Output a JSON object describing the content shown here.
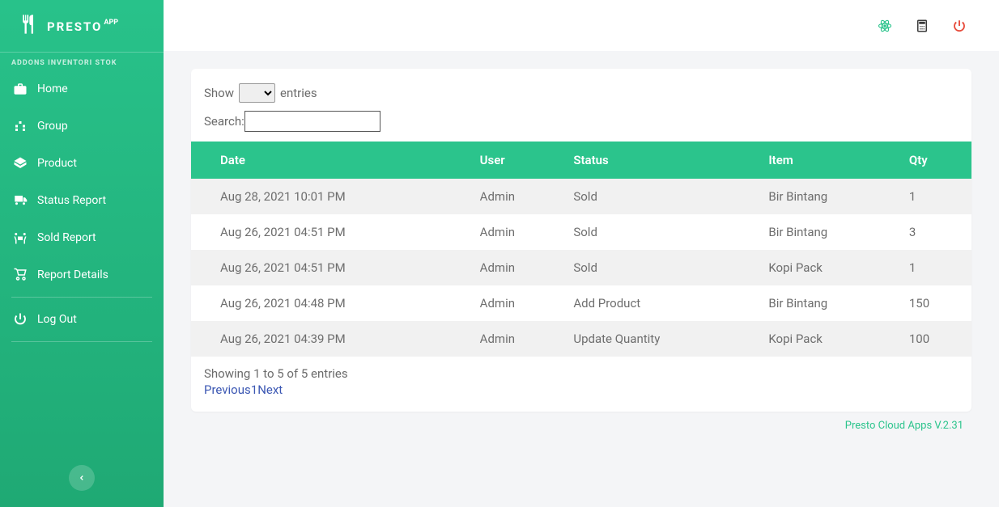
{
  "brand": {
    "name": "PRESTO",
    "sup": "APP"
  },
  "sidebar": {
    "section_label": "ADDONS INVENTORI STOK",
    "items": [
      {
        "label": "Home"
      },
      {
        "label": "Group"
      },
      {
        "label": "Product"
      },
      {
        "label": "Status Report"
      },
      {
        "label": "Sold Report"
      },
      {
        "label": "Report Details"
      }
    ],
    "logout_label": "Log Out"
  },
  "controls": {
    "show_prefix": "Show",
    "show_suffix": "entries",
    "search_label": "Search:"
  },
  "table": {
    "headers": {
      "date": "Date",
      "user": "User",
      "status": "Status",
      "item": "Item",
      "qty": "Qty"
    },
    "rows": [
      {
        "date": "Aug 28, 2021 10:01 PM",
        "user": "Admin",
        "status": "Sold",
        "item": "Bir Bintang",
        "qty": "1"
      },
      {
        "date": "Aug 26, 2021 04:51 PM",
        "user": "Admin",
        "status": "Sold",
        "item": "Bir Bintang",
        "qty": "3"
      },
      {
        "date": "Aug 26, 2021 04:51 PM",
        "user": "Admin",
        "status": "Sold",
        "item": "Kopi Pack",
        "qty": "1"
      },
      {
        "date": "Aug 26, 2021 04:48 PM",
        "user": "Admin",
        "status": "Add Product",
        "item": "Bir Bintang",
        "qty": "150"
      },
      {
        "date": "Aug 26, 2021 04:39 PM",
        "user": "Admin",
        "status": "Update Quantity",
        "item": "Kopi Pack",
        "qty": "100"
      }
    ]
  },
  "footer_info": "Showing 1 to 5 of 5 entries",
  "pagination": {
    "prev": "Previous",
    "page": "1",
    "next": "Next"
  },
  "app_version": "Presto Cloud Apps V.2.31",
  "colors": {
    "accent": "#2bc48c",
    "danger": "#e74c3c"
  }
}
